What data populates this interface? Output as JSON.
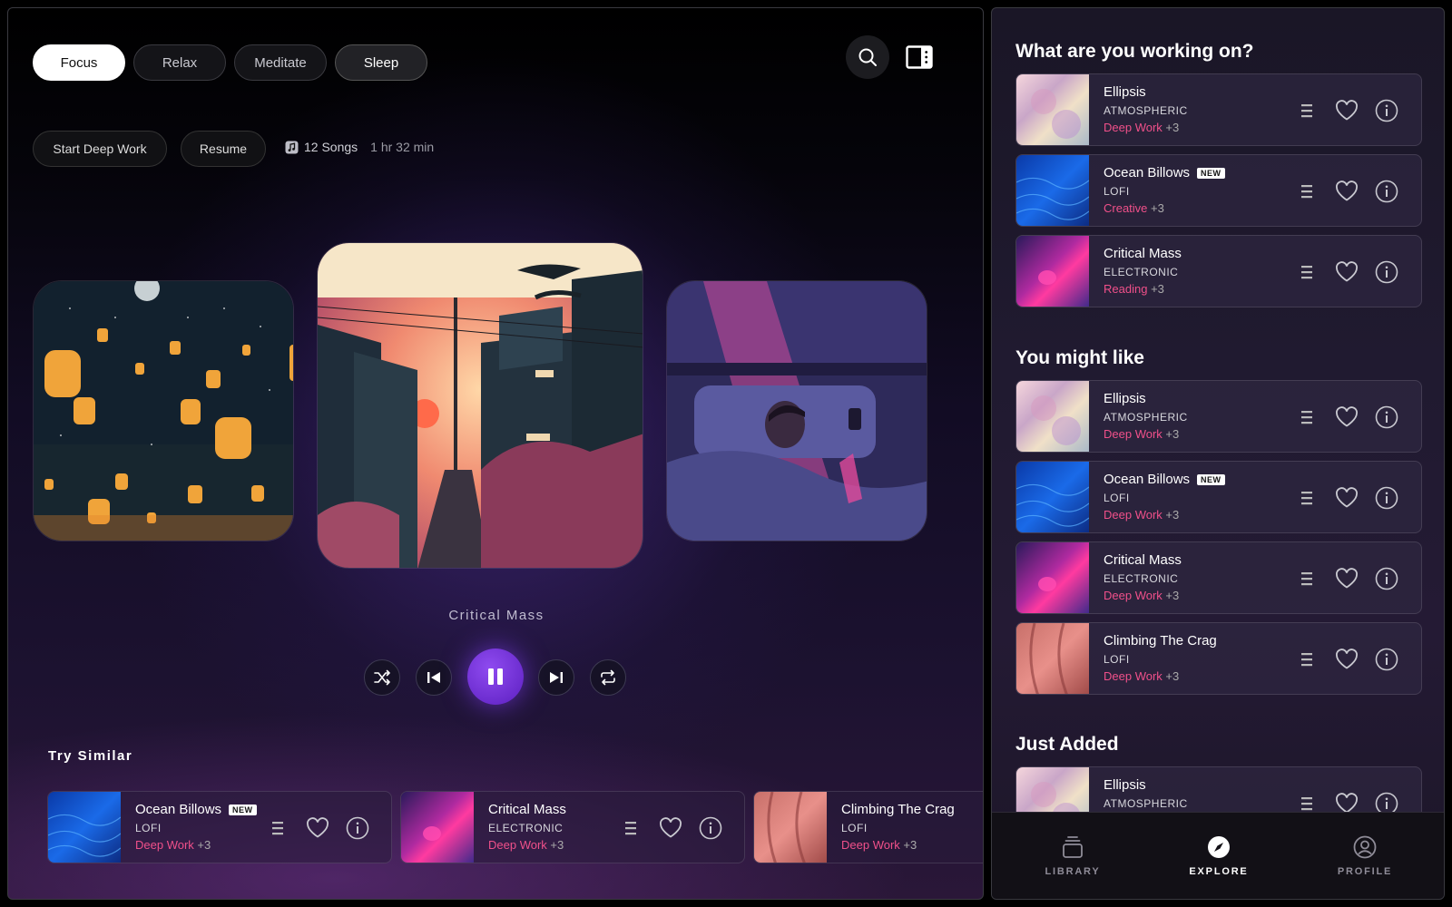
{
  "header": {
    "modes": [
      {
        "label": "Focus",
        "state": "active"
      },
      {
        "label": "Relax",
        "state": "normal"
      },
      {
        "label": "Meditate",
        "state": "normal"
      },
      {
        "label": "Sleep",
        "state": "highlighted"
      }
    ],
    "search_icon": "search-icon",
    "panel_icon": "sidebar-toggle-icon"
  },
  "playlist": {
    "start_label": "Start Deep Work",
    "resume_label": "Resume",
    "songs_label": "12 Songs",
    "duration_label": "1 hr 32 min"
  },
  "now_playing": {
    "title": "Critical Mass"
  },
  "controls": {
    "shuffle": "shuffle-icon",
    "previous": "skip-back-icon",
    "play_pause": "pause-icon",
    "next": "skip-forward-icon",
    "repeat": "repeat-icon"
  },
  "try_similar": {
    "heading": "Try Similar",
    "items": [
      {
        "title": "Ocean Billows",
        "badge": "NEW",
        "genre": "LOFI",
        "tag": "Deep Work",
        "more": "+3"
      },
      {
        "title": "Critical Mass",
        "badge": "",
        "genre": "ELECTRONIC",
        "tag": "Deep Work",
        "more": "+3"
      },
      {
        "title": "Climbing The Crag",
        "badge": "",
        "genre": "LOFI",
        "tag": "Deep Work",
        "more": "+3"
      }
    ]
  },
  "sidebar": {
    "working_heading": "What are you working on?",
    "working": [
      {
        "title": "Ellipsis",
        "badge": "",
        "genre": "ATMOSPHERIC",
        "tag": "Deep Work",
        "more": "+3"
      },
      {
        "title": "Ocean Billows",
        "badge": "NEW",
        "genre": "LOFI",
        "tag": "Creative",
        "more": "+3"
      },
      {
        "title": "Critical Mass",
        "badge": "",
        "genre": "ELECTRONIC",
        "tag": "Reading",
        "more": "+3"
      }
    ],
    "like_heading": "You might like",
    "like": [
      {
        "title": "Ellipsis",
        "badge": "",
        "genre": "ATMOSPHERIC",
        "tag": "Deep Work",
        "more": "+3"
      },
      {
        "title": "Ocean Billows",
        "badge": "NEW",
        "genre": "LOFI",
        "tag": "Deep Work",
        "more": "+3"
      },
      {
        "title": "Critical Mass",
        "badge": "",
        "genre": "ELECTRONIC",
        "tag": "Deep Work",
        "more": "+3"
      },
      {
        "title": "Climbing The Crag",
        "badge": "",
        "genre": "LOFI",
        "tag": "Deep Work",
        "more": "+3"
      }
    ],
    "added_heading": "Just Added",
    "added": [
      {
        "title": "Ellipsis",
        "badge": "",
        "genre": "ATMOSPHERIC",
        "tag": "",
        "more": ""
      }
    ]
  },
  "tabs": [
    {
      "label": "LIBRARY",
      "icon": "library-icon",
      "active": false
    },
    {
      "label": "EXPLORE",
      "icon": "compass-icon",
      "active": true
    },
    {
      "label": "PROFILE",
      "icon": "profile-icon",
      "active": false
    }
  ],
  "colors": {
    "accent": "#7c3aed",
    "tag": "#f0508a"
  }
}
